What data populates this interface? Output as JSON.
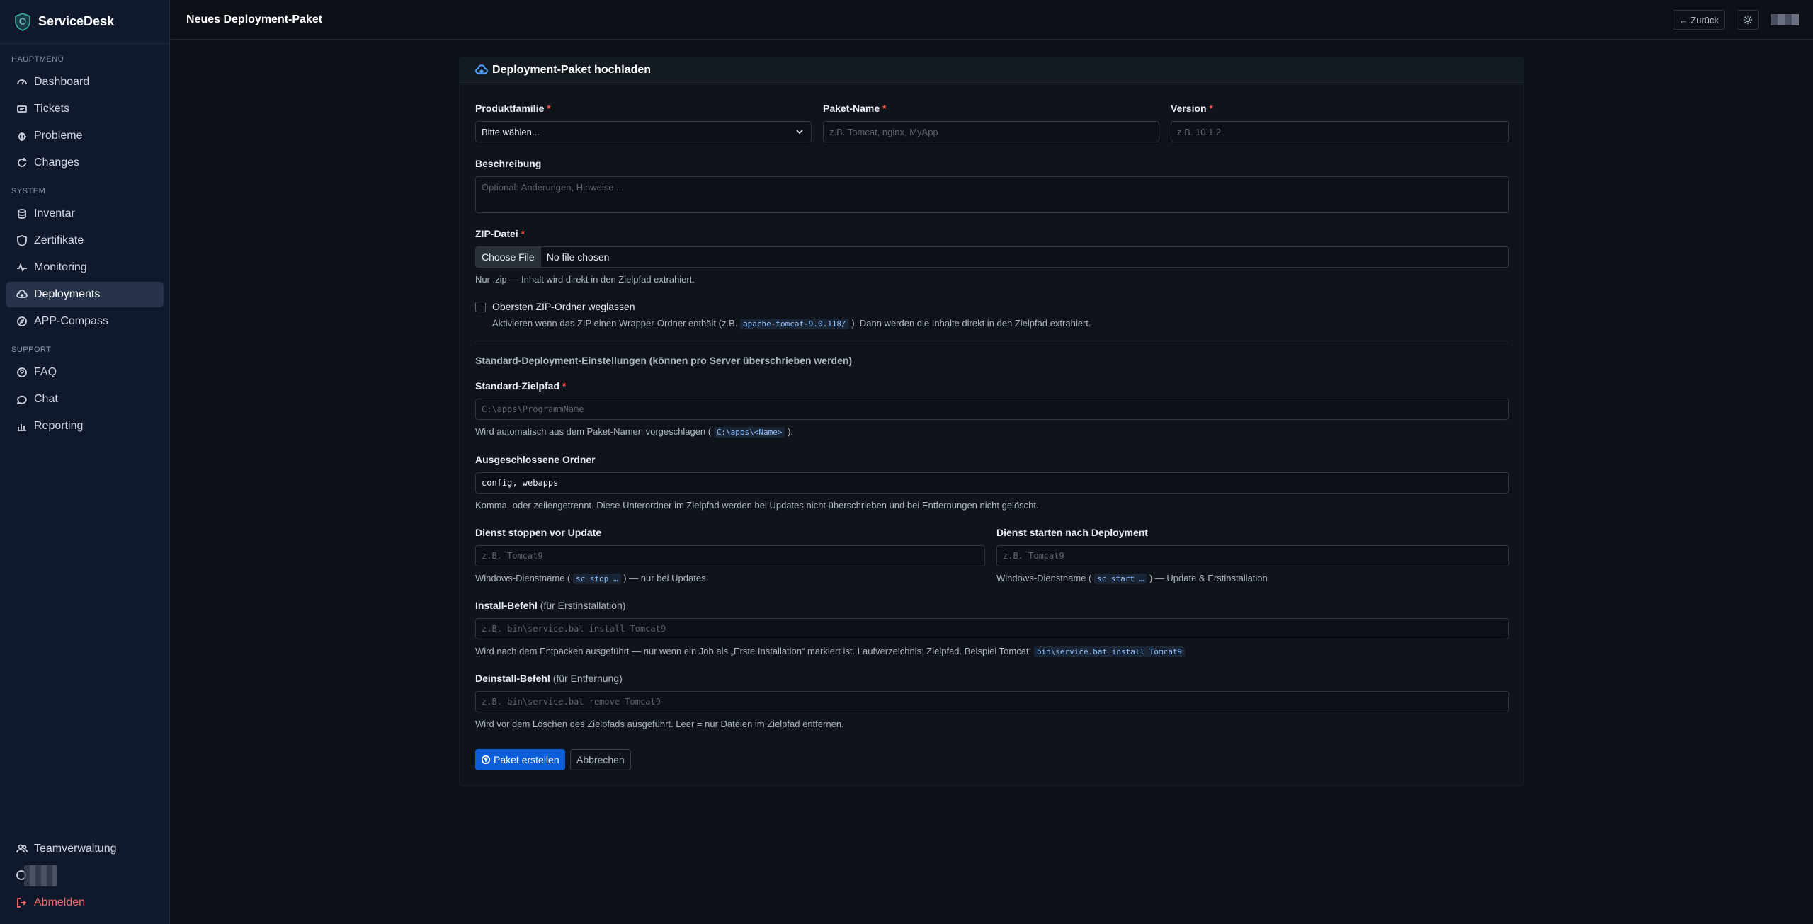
{
  "brand": {
    "name": "ServiceDesk"
  },
  "sidebar": {
    "sections": [
      {
        "label": "HAUPTMENÜ",
        "items": [
          {
            "label": "Dashboard",
            "icon": "speedometer-icon"
          },
          {
            "label": "Tickets",
            "icon": "ticket-icon"
          },
          {
            "label": "Probleme",
            "icon": "bug-icon"
          },
          {
            "label": "Changes",
            "icon": "refresh-icon"
          }
        ]
      },
      {
        "label": "SYSTEM",
        "items": [
          {
            "label": "Inventar",
            "icon": "database-icon"
          },
          {
            "label": "Zertifikate",
            "icon": "shield-icon"
          },
          {
            "label": "Monitoring",
            "icon": "activity-icon"
          },
          {
            "label": "Deployments",
            "icon": "cloud-upload-icon",
            "active": true
          },
          {
            "label": "APP-Compass",
            "icon": "compass-icon"
          }
        ]
      },
      {
        "label": "SUPPORT",
        "items": [
          {
            "label": "FAQ",
            "icon": "question-circle-icon"
          },
          {
            "label": "Chat",
            "icon": "chat-icon"
          },
          {
            "label": "Reporting",
            "icon": "bar-chart-icon"
          }
        ]
      }
    ],
    "bottom": {
      "team": "Teamverwaltung",
      "logout": "Abmelden"
    }
  },
  "topbar": {
    "title": "Neues Deployment-Paket",
    "back": "← Zurück"
  },
  "card": {
    "title": "Deployment-Paket hochladen",
    "fields": {
      "product_family": {
        "label": "Produktfamilie",
        "req": "*",
        "value": "Bitte wählen..."
      },
      "package_name": {
        "label": "Paket-Name",
        "req": "*",
        "placeholder": "z.B. Tomcat, nginx, MyApp"
      },
      "version": {
        "label": "Version",
        "req": "*",
        "placeholder": "z.B. 10.1.2"
      },
      "description": {
        "label": "Beschreibung",
        "placeholder": "Optional: Änderungen, Hinweise ..."
      },
      "zip": {
        "label": "ZIP-Datei",
        "req": "*",
        "button": "Choose File",
        "status": "No file chosen",
        "help": "Nur .zip — Inhalt wird direkt in den Zielpfad extrahiert."
      },
      "strip_root": {
        "label": "Obersten ZIP-Ordner weglassen",
        "help_pre": "Aktivieren wenn das ZIP einen Wrapper-Ordner enthält (z.B.",
        "help_code": "apache-tomcat-9.0.118/",
        "help_post": "). Dann werden die Inhalte direkt in den Zielpfad extrahiert."
      },
      "defaults_heading": "Standard-Deployment-Einstellungen (können pro Server überschrieben werden)",
      "target_path": {
        "label": "Standard-Zielpfad",
        "req": "*",
        "placeholder": "C:\\apps\\ProgrammName",
        "help_pre": "Wird automatisch aus dem Paket-Namen vorgeschlagen (",
        "help_code": "C:\\apps\\<Name>",
        "help_post": ")."
      },
      "excluded": {
        "label": "Ausgeschlossene Ordner",
        "value": "config, webapps",
        "help": "Komma- oder zeilengetrennt. Diese Unterordner im Zielpfad werden bei Updates nicht überschrieben und bei Entfernungen nicht gelöscht."
      },
      "stop_service": {
        "label": "Dienst stoppen vor Update",
        "placeholder": "z.B. Tomcat9",
        "help_pre": "Windows-Dienstname (",
        "help_code": "sc stop …",
        "help_post": ") — nur bei Updates"
      },
      "start_service": {
        "label": "Dienst starten nach Deployment",
        "placeholder": "z.B. Tomcat9",
        "help_pre": "Windows-Dienstname (",
        "help_code": "sc start …",
        "help_post": ") — Update & Erstinstallation"
      },
      "install_cmd": {
        "label": "Install-Befehl",
        "hint": "(für Erstinstallation)",
        "placeholder": "z.B. bin\\service.bat install Tomcat9",
        "help_pre": "Wird nach dem Entpacken ausgeführt — nur wenn ein Job als „Erste Installation“ markiert ist. Laufverzeichnis: Zielpfad. Beispiel Tomcat:",
        "help_code": "bin\\service.bat install Tomcat9"
      },
      "uninstall_cmd": {
        "label": "Deinstall-Befehl",
        "hint": "(für Entfernung)",
        "placeholder": "z.B. bin\\service.bat remove Tomcat9",
        "help": "Wird vor dem Löschen des Zielpfads ausgeführt. Leer = nur Dateien im Zielpfad entfernen."
      }
    },
    "actions": {
      "create": "Paket erstellen",
      "cancel": "Abbrechen"
    }
  }
}
